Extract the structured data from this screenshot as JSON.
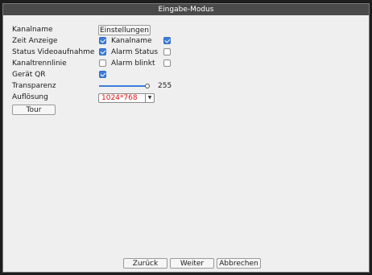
{
  "dialog": {
    "title": "Eingabe-Modus"
  },
  "fields": {
    "kanalname_label": "Kanalname",
    "einstellungen_button": "Einstellungen",
    "zeit_anzeige_label": "Zeit Anzeige",
    "zeit_anzeige_checked": true,
    "kanalname_toggle_label": "Kanalname",
    "kanalname_toggle_checked": true,
    "status_video_label": "Status Videoaufnahme",
    "status_video_checked": true,
    "alarm_status_label": "Alarm Status",
    "alarm_status_checked": false,
    "kanaltrennlinie_label": "Kanaltrennlinie",
    "kanaltrennlinie_checked": false,
    "alarm_blinkt_label": "Alarm blinkt",
    "alarm_blinkt_checked": false,
    "geraet_qr_label": "Gerät QR",
    "geraet_qr_checked": true,
    "transparenz_label": "Transparenz",
    "transparenz_value": "255",
    "transparenz_fraction": 1.0,
    "aufloesung_label": "Auflösung",
    "aufloesung_value": "1024*768",
    "tour_button": "Tour"
  },
  "footer": {
    "back": "Zurück",
    "next": "Weiter",
    "cancel": "Abbrechen"
  },
  "colors": {
    "accent": "#3b7ddd",
    "title_bg": "#4a4a4a",
    "select_text": "#e01010"
  }
}
